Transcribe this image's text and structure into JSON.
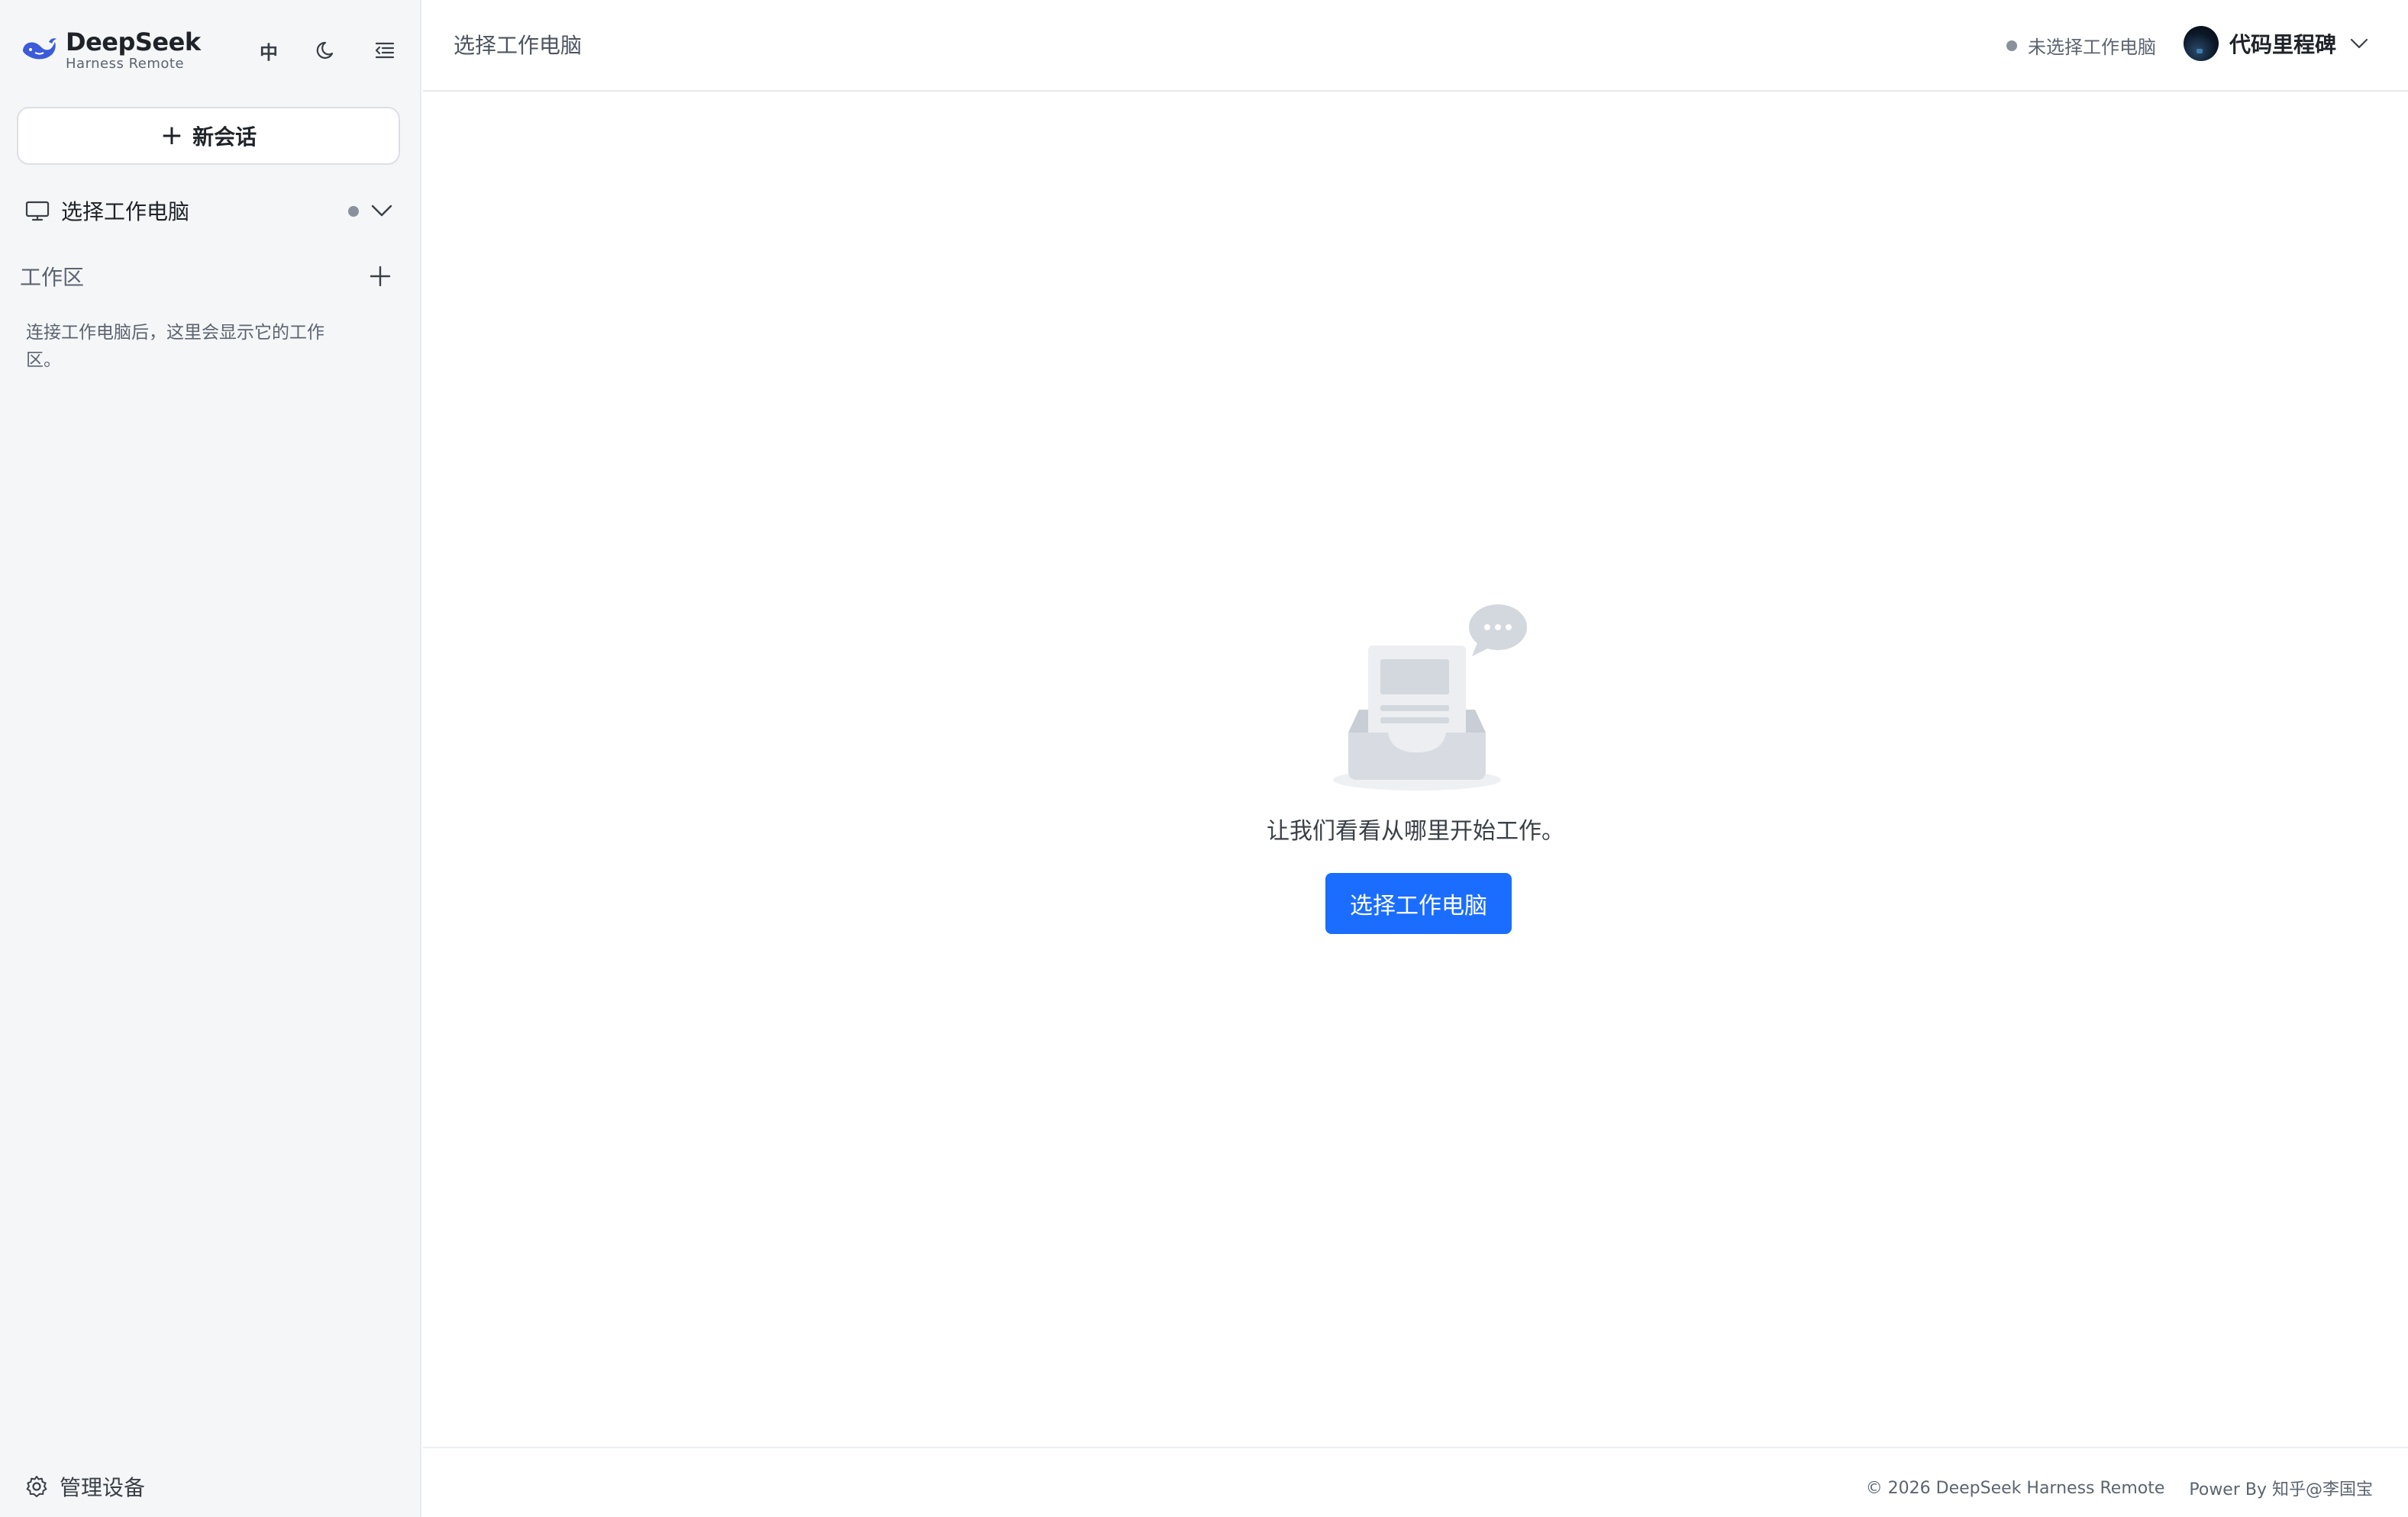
{
  "brand": {
    "name": "DeepSeek",
    "subtitle": "Harness Remote"
  },
  "toolbar": {
    "language_label": "中",
    "theme_icon": "moon-icon",
    "collapse_icon": "collapse-sidebar-icon"
  },
  "sidebar": {
    "new_chat_label": "新会话",
    "pc_selector_label": "选择工作电脑",
    "workspace_title": "工作区",
    "workspace_empty_text": "连接工作电脑后，这里会显示它的工作区。",
    "manage_devices_label": "管理设备"
  },
  "header": {
    "title": "选择工作电脑",
    "status_text": "未选择工作电脑",
    "user_name": "代码里程碑"
  },
  "main": {
    "empty_text": "让我们看看从哪里开始工作。",
    "primary_button_label": "选择工作电脑"
  },
  "footer": {
    "copyright": "© 2026 DeepSeek Harness Remote",
    "power_by": "Power By 知乎@李国宝"
  },
  "colors": {
    "accent": "#1a6dff",
    "sidebar_bg": "#f5f6f8",
    "status_dot": "#8a919c"
  }
}
